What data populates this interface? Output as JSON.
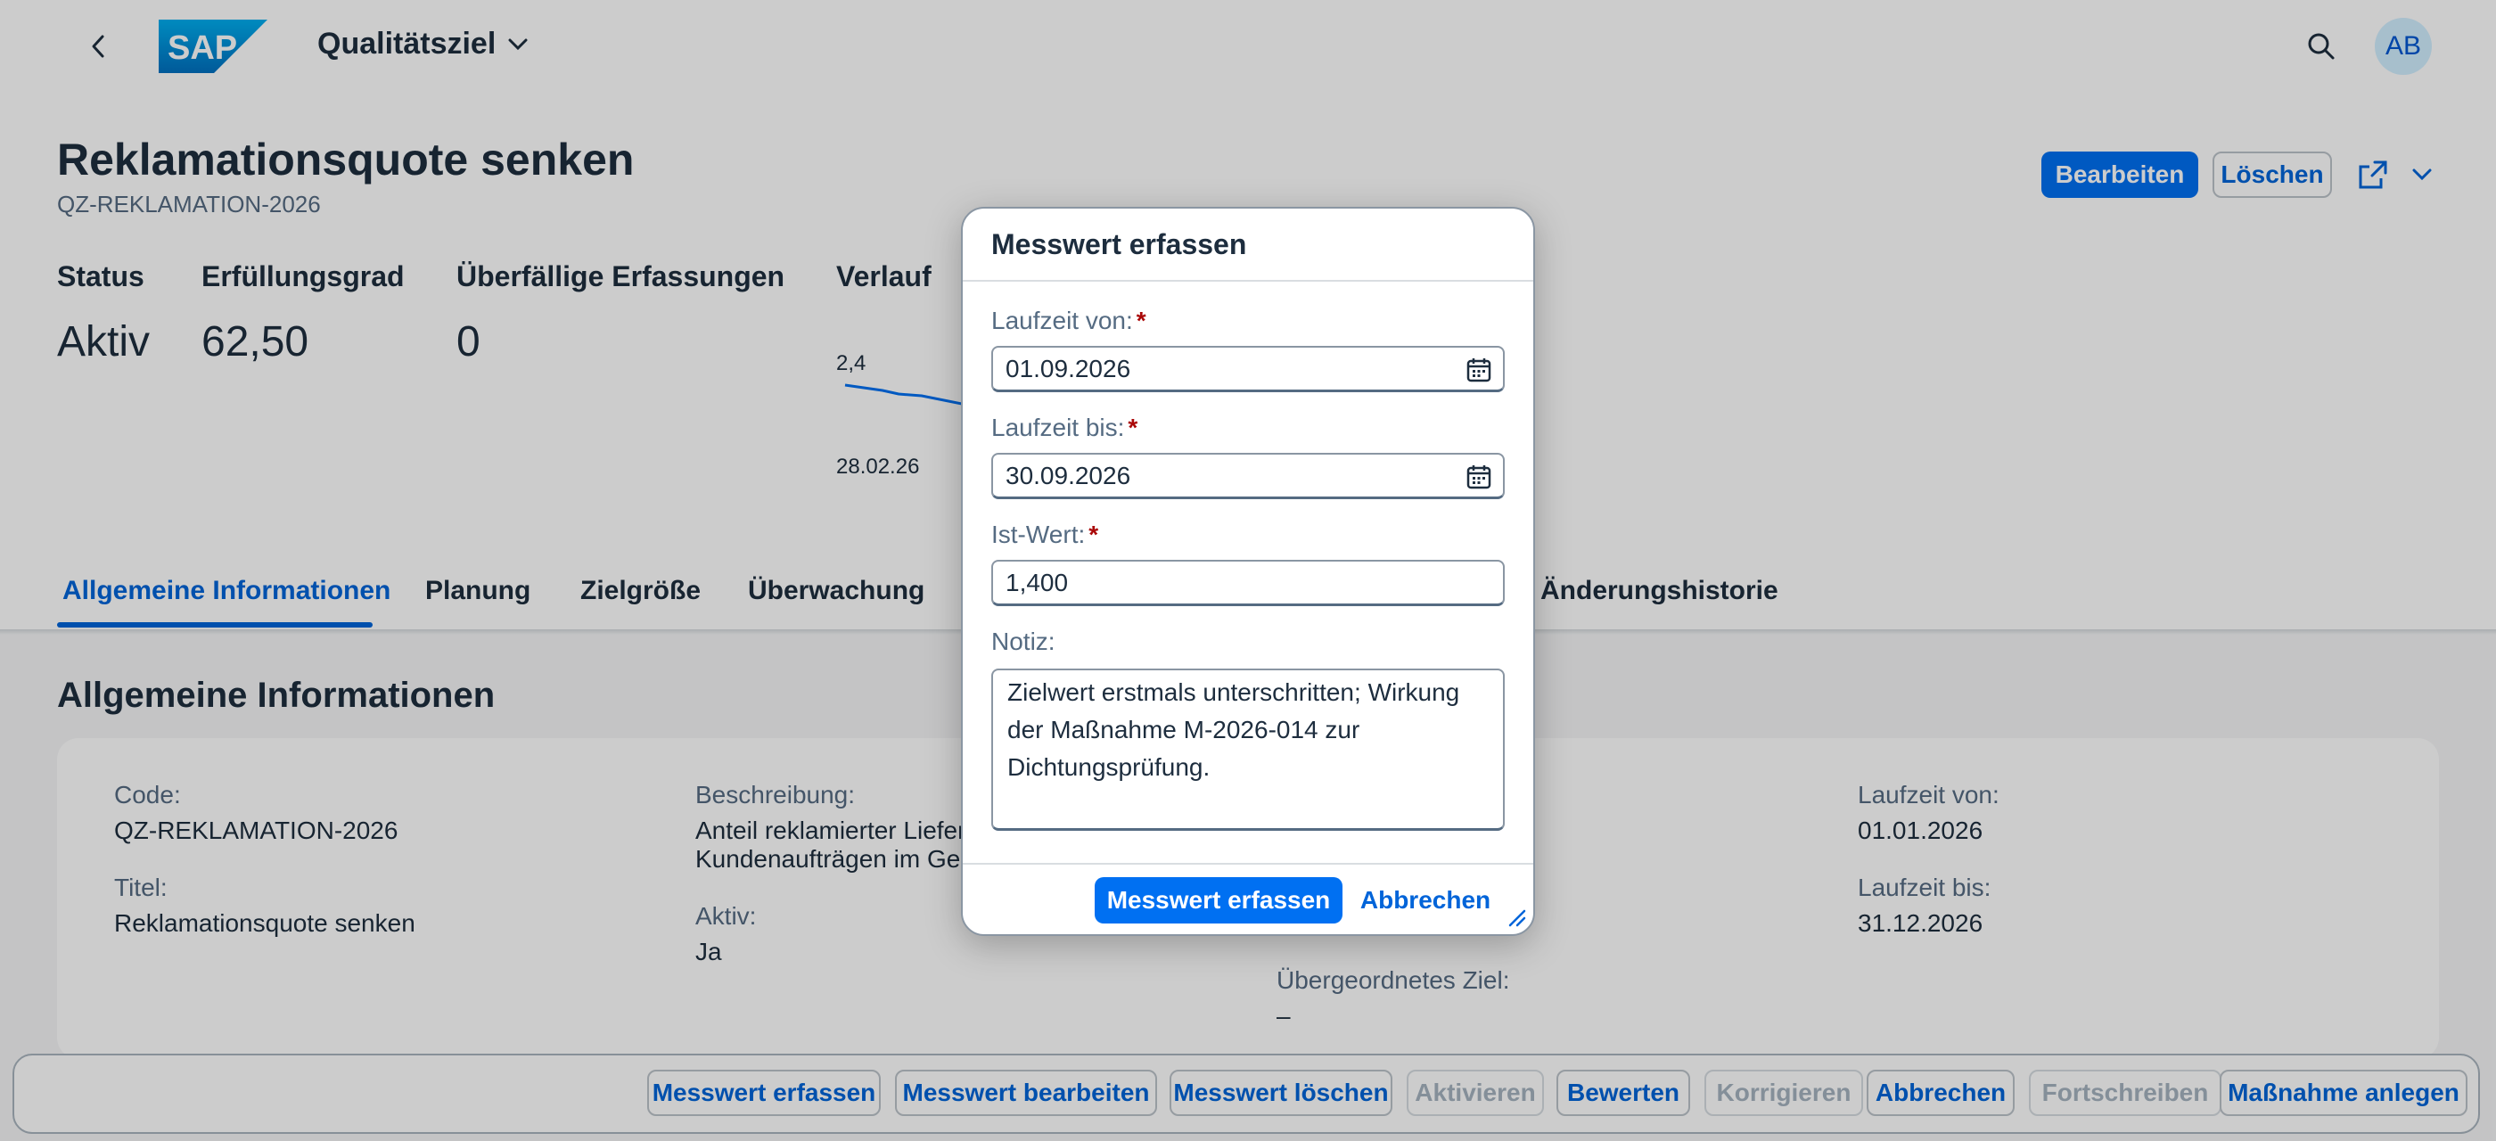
{
  "shellbar": {
    "logo_text": "SAP",
    "app_title": "Qualitätsziel",
    "avatar_initials": "AB"
  },
  "header": {
    "title": "Reklamationsquote senken",
    "subtitle": "QZ-REKLAMATION-2026",
    "actions": {
      "edit": "Bearbeiten",
      "delete": "Löschen"
    },
    "kpis": [
      {
        "label": "Status",
        "value": "Aktiv"
      },
      {
        "label": "Erfüllungsgrad",
        "value": "62,50"
      },
      {
        "label": "Überfällige Erfassungen",
        "value": "0"
      }
    ],
    "trend": {
      "label": "Verlauf",
      "top_value": "2,4",
      "start_date": "28.02.26"
    }
  },
  "tabs": [
    {
      "label": "Allgemeine Informationen",
      "active": true
    },
    {
      "label": "Planung"
    },
    {
      "label": "Zielgröße"
    },
    {
      "label": "Überwachung"
    },
    {
      "label": "Änderungshistorie"
    }
  ],
  "section": {
    "title": "Allgemeine Informationen",
    "fields": {
      "code": {
        "label": "Code:",
        "value": "QZ-REKLAMATION-2026"
      },
      "titel": {
        "label": "Titel:",
        "value": "Reklamationsquote senken"
      },
      "beschreibung": {
        "label": "Beschreibung:",
        "line1": "Anteil reklamierter Liefer",
        "line2": "Kundenaufträgen im Ges"
      },
      "aktiv": {
        "label": "Aktiv:",
        "value": "Ja"
      },
      "uebergeordnet": {
        "label": "Übergeordnetes Ziel:",
        "value": "–"
      },
      "laufzeit_von": {
        "label": "Laufzeit von:",
        "value": "01.01.2026"
      },
      "laufzeit_bis": {
        "label": "Laufzeit bis:",
        "value": "31.12.2026"
      }
    }
  },
  "footer": {
    "buttons": [
      {
        "label": "Messwert erfassen",
        "enabled": true
      },
      {
        "label": "Messwert bearbeiten",
        "enabled": true
      },
      {
        "label": "Messwert löschen",
        "enabled": true
      },
      {
        "label": "Aktivieren",
        "enabled": false
      },
      {
        "label": "Bewerten",
        "enabled": true
      },
      {
        "label": "Korrigieren",
        "enabled": false
      },
      {
        "label": "Abbrechen",
        "enabled": true
      },
      {
        "label": "Fortschreiben",
        "enabled": false
      },
      {
        "label": "Maßnahme anlegen",
        "enabled": true
      }
    ]
  },
  "dialog": {
    "title": "Messwert erfassen",
    "fields": {
      "laufzeit_von": {
        "label": "Laufzeit von:",
        "value": "01.09.2026"
      },
      "laufzeit_bis": {
        "label": "Laufzeit bis:",
        "value": "30.09.2026"
      },
      "ist_wert": {
        "label": "Ist-Wert:",
        "value": "1,400"
      },
      "notiz": {
        "label": "Notiz:",
        "value": "Zielwert erstmals unterschritten; Wirkung der Maßnahme M-2026-014 zur Dichtungsprüfung."
      }
    },
    "required_marker": "*",
    "confirm": "Messwert erfassen",
    "cancel": "Abbrechen"
  },
  "colors": {
    "brand": "#0070f2",
    "link": "#0064d9",
    "required": "#aa0808",
    "logo": "#0a6ed1"
  },
  "icons": [
    "back-icon",
    "chevron-down-icon",
    "search-icon",
    "share-icon",
    "calendar-icon",
    "resize-handle-icon"
  ]
}
